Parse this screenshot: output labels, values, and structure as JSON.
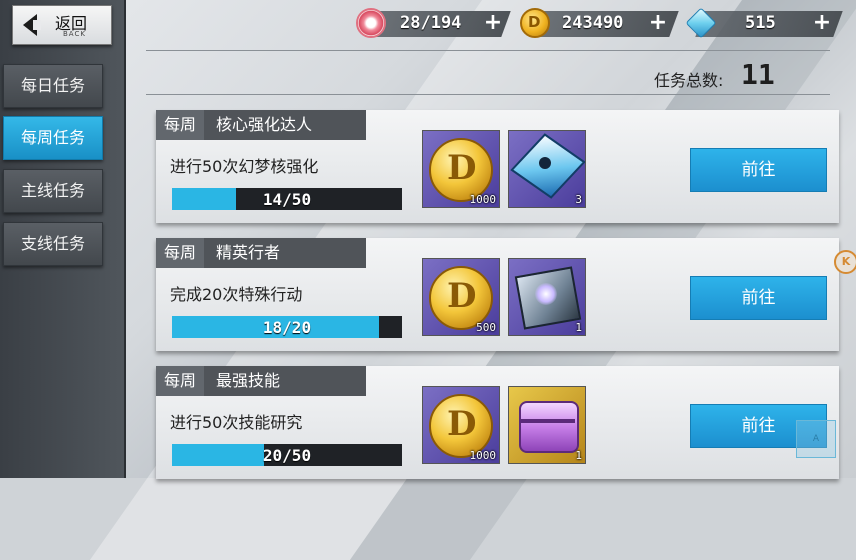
{
  "back": {
    "label": "返回",
    "sub": "BACK"
  },
  "sidebar": {
    "items": [
      {
        "label": "每日任务",
        "active": false
      },
      {
        "label": "每周任务",
        "active": true
      },
      {
        "label": "主线任务",
        "active": false
      },
      {
        "label": "支线任务",
        "active": false
      }
    ]
  },
  "resources": [
    {
      "icon": "ticket-icon",
      "value": "28/194",
      "plus": "+"
    },
    {
      "icon": "coin-icon",
      "value": "243490",
      "plus": "+"
    },
    {
      "icon": "crystal-icon",
      "value": "515",
      "plus": "+"
    }
  ],
  "total": {
    "label": "任务总数:",
    "value": "11"
  },
  "tasks": [
    {
      "tag": "每周",
      "name": "核心强化达人",
      "desc": "进行50次幻梦核强化",
      "progress_text": "14/50",
      "progress": 0.28,
      "rewards": [
        {
          "icon": "gold-coin-icon",
          "count": "1000"
        },
        {
          "icon": "core-cube-icon",
          "count": "3"
        }
      ],
      "button": "前往"
    },
    {
      "tag": "每周",
      "name": "精英行者",
      "desc": "完成20次特殊行动",
      "progress_text": "18/20",
      "progress": 0.9,
      "rewards": [
        {
          "icon": "gold-coin-icon",
          "count": "500"
        },
        {
          "icon": "crystal-box-icon",
          "count": "1"
        }
      ],
      "button": "前往"
    },
    {
      "tag": "每周",
      "name": "最强技能",
      "desc": "进行50次技能研究",
      "progress_text": "20/50",
      "progress": 0.4,
      "rewards": [
        {
          "icon": "gold-coin-icon",
          "count": "1000"
        },
        {
          "icon": "purple-chest-icon",
          "count": "1"
        }
      ],
      "button": "前往"
    }
  ],
  "side_badge": "K",
  "corner_button": "A",
  "colors": {
    "accent": "#2ab6e4",
    "sidebar": "#43484d",
    "card": "#e9ebee"
  }
}
